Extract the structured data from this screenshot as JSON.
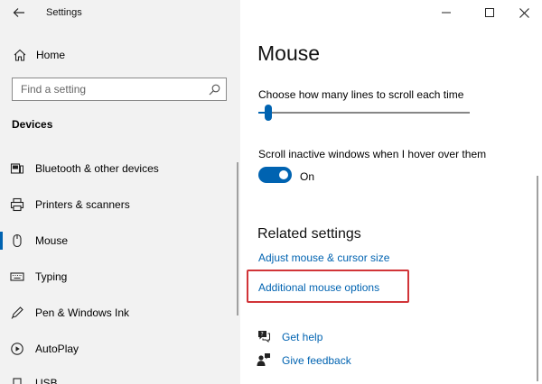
{
  "window": {
    "app_title": "Settings"
  },
  "sidebar": {
    "home_label": "Home",
    "search_placeholder": "Find a setting",
    "section_title": "Devices",
    "items": [
      {
        "label": "Bluetooth & other devices",
        "icon": "bluetooth-icon",
        "selected": false
      },
      {
        "label": "Printers & scanners",
        "icon": "printer-icon",
        "selected": false
      },
      {
        "label": "Mouse",
        "icon": "mouse-icon",
        "selected": true
      },
      {
        "label": "Typing",
        "icon": "keyboard-icon",
        "selected": false
      },
      {
        "label": "Pen & Windows Ink",
        "icon": "pen-icon",
        "selected": false
      },
      {
        "label": "AutoPlay",
        "icon": "autoplay-icon",
        "selected": false
      },
      {
        "label": "USB",
        "icon": "usb-icon",
        "selected": false
      }
    ]
  },
  "main": {
    "title": "Mouse",
    "scroll_lines_label": "Choose how many lines to scroll each time",
    "scroll_lines_fraction": 0.03,
    "inactive_scroll_label": "Scroll inactive windows when I hover over them",
    "inactive_scroll_state": "On",
    "related_heading": "Related settings",
    "related_links": [
      "Adjust mouse & cursor size",
      "Additional mouse options"
    ],
    "help_links": [
      {
        "label": "Get help",
        "icon": "help-chat-icon"
      },
      {
        "label": "Give feedback",
        "icon": "feedback-icon"
      }
    ]
  },
  "colors": {
    "accent": "#0063b1",
    "highlight": "#d13438",
    "sidebar_bg": "#f2f2f2"
  }
}
